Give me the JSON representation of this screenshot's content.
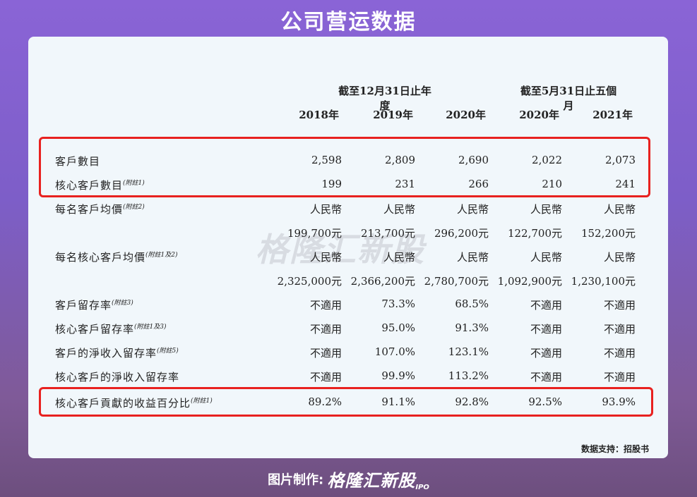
{
  "title": "公司营运数据",
  "headers": {
    "period1": "截至12月31日止年度",
    "period2": "截至5月31日止五個月",
    "years": [
      "2018年",
      "2019年",
      "2020年",
      "2020年",
      "2021年"
    ]
  },
  "rows": [
    {
      "label": "客戶數目",
      "note": "",
      "lines": [
        [
          "2,598",
          "2,809",
          "2,690",
          "2,022",
          "2,073"
        ]
      ]
    },
    {
      "label": "核心客戶數目",
      "note": "(附註1)",
      "lines": [
        [
          "199",
          "231",
          "266",
          "210",
          "241"
        ]
      ]
    },
    {
      "label": "每名客戶均價",
      "note": "(附註2)",
      "lines": [
        [
          "人民幣",
          "人民幣",
          "人民幣",
          "人民幣",
          "人民幣"
        ],
        [
          "199,700元",
          "213,700元",
          "296,200元",
          "122,700元",
          "152,200元"
        ]
      ]
    },
    {
      "label": "每名核心客戶均價",
      "note": "(附註1及2)",
      "lines": [
        [
          "人民幣",
          "人民幣",
          "人民幣",
          "人民幣",
          "人民幣"
        ],
        [
          "2,325,000元",
          "2,366,200元",
          "2,780,700元",
          "1,092,900元",
          "1,230,100元"
        ]
      ]
    },
    {
      "label": "客戶留存率",
      "note": "(附註3)",
      "lines": [
        [
          "不適用",
          "73.3%",
          "68.5%",
          "不適用",
          "不適用"
        ]
      ]
    },
    {
      "label": "核心客戶留存率",
      "note": "(附註1及3)",
      "lines": [
        [
          "不適用",
          "95.0%",
          "91.3%",
          "不適用",
          "不適用"
        ]
      ]
    },
    {
      "label": "客戶的淨收入留存率",
      "note": "(附註5)",
      "lines": [
        [
          "不適用",
          "107.0%",
          "123.1%",
          "不適用",
          "不適用"
        ]
      ]
    },
    {
      "label": "核心客戶的淨收入留存率",
      "note": "",
      "lines": [
        [
          "不適用",
          "99.9%",
          "113.2%",
          "不適用",
          "不適用"
        ]
      ]
    },
    {
      "label": "核心客戶貢獻的收益百分比",
      "note": "(附註1)",
      "lines": [
        [
          "89.2%",
          "91.1%",
          "92.8%",
          "92.5%",
          "93.9%"
        ]
      ]
    }
  ],
  "watermark": "格隆汇新股",
  "source": "数据支持：招股书",
  "footer": {
    "label": "图片制作:",
    "brand": "格隆汇新股",
    "ipo": "IPO"
  },
  "colors": {
    "highlight": "#e8211f",
    "card": "#f1f7fb"
  }
}
